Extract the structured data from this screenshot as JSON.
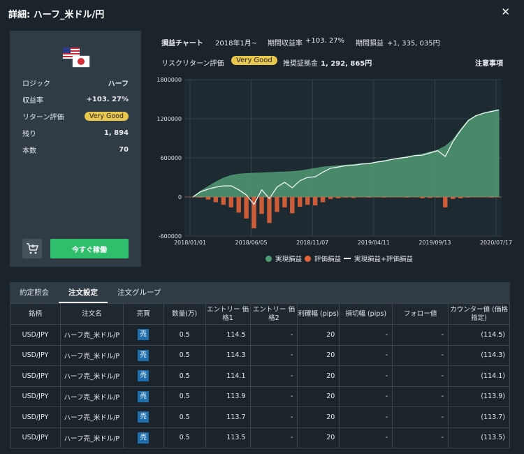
{
  "title": "詳細: ハーフ_米ドル/円",
  "close_icon": "close-icon",
  "card": {
    "rows": [
      {
        "label": "ロジック",
        "value": "ハーフ"
      },
      {
        "label": "収益率",
        "value": "+103. 27%"
      },
      {
        "label": "リターン評価",
        "value": "Very Good"
      },
      {
        "label": "残り",
        "value": "1, 894"
      },
      {
        "label": "本数",
        "value": "70"
      }
    ],
    "cart_icon": "cart-add-icon",
    "operate_label": "今すぐ稼働"
  },
  "header": {
    "chart_label": "損益チャート",
    "start_label": "2018年1月~",
    "period_return_label": "期間収益率",
    "period_return_value": "+103. 27%",
    "period_pl_label": "期間損益",
    "period_pl_value": "+1, 335, 035円",
    "risk_label": "リスクリターン評価",
    "risk_badge": "Very Good",
    "margin_label": "推奨証拠金",
    "margin_value": "1, 292, 865円",
    "notes_label": "注意事項"
  },
  "chart_data": {
    "type": "area",
    "x_ticks": [
      "2018/01/01",
      "2018/06/05",
      "2018/11/07",
      "2019/04/11",
      "2019/09/13",
      "2020/07/17"
    ],
    "y_ticks": [
      "1800000",
      "1200000",
      "600000",
      "0",
      "-600000"
    ],
    "ylim": [
      -600000,
      1800000
    ],
    "grid": true,
    "legend_position": "bottom",
    "series": [
      {
        "name": "実現損益",
        "color": "#4f9a73",
        "kind": "area",
        "values": [
          0,
          90000,
          160000,
          230000,
          290000,
          330000,
          350000,
          360000,
          365000,
          370000,
          375000,
          380000,
          385000,
          390000,
          400000,
          420000,
          440000,
          460000,
          470000,
          480000,
          490000,
          500000,
          510000,
          520000,
          540000,
          560000,
          580000,
          600000,
          620000,
          640000,
          660000,
          690000,
          720000,
          780000,
          880000,
          1040000,
          1180000,
          1250000,
          1290000,
          1320000,
          1340000
        ]
      },
      {
        "name": "評価損益",
        "color": "#e0633a",
        "kind": "bars",
        "values": [
          0,
          -10000,
          -40000,
          -80000,
          -120000,
          -160000,
          -240000,
          -330000,
          -480000,
          -260000,
          -400000,
          -230000,
          -160000,
          -250000,
          -150000,
          -120000,
          -130000,
          -80000,
          -30000,
          -20000,
          -10000,
          -15000,
          -5000,
          -10000,
          -5000,
          -10000,
          -5000,
          -5000,
          -10000,
          -5000,
          -20000,
          -15000,
          -10000,
          -160000,
          -30000,
          -20000,
          -10000,
          -5000,
          -5000,
          -10000,
          -5000
        ]
      },
      {
        "name": "実現損益+評価損益",
        "color": "#ffffff",
        "kind": "line",
        "values": [
          0,
          80000,
          120000,
          150000,
          170000,
          170000,
          110000,
          30000,
          -115000,
          110000,
          -25000,
          150000,
          225000,
          140000,
          250000,
          300000,
          310000,
          380000,
          440000,
          460000,
          480000,
          485000,
          505000,
          510000,
          535000,
          550000,
          575000,
          595000,
          610000,
          635000,
          640000,
          675000,
          710000,
          620000,
          850000,
          1020000,
          1170000,
          1245000,
          1285000,
          1310000,
          1335000
        ]
      }
    ]
  },
  "tabs": [
    "約定照会",
    "注文設定",
    "注文グループ"
  ],
  "table": {
    "headers": [
      "銘柄",
      "注文名",
      "売買",
      "数量(万)",
      "エントリー 価格1",
      "エントリー 価格2",
      "利確幅 (pips)",
      "損切幅 (pips)",
      "フォロー値",
      "カウンター値 (価格指定)"
    ],
    "rows": [
      [
        "USD/JPY",
        "ハーフ売_米ドル/P",
        "売",
        "0.5",
        "114.5",
        "-",
        "20",
        "-",
        "-",
        "(114.5)"
      ],
      [
        "USD/JPY",
        "ハーフ売_米ドル/P",
        "売",
        "0.5",
        "114.3",
        "-",
        "20",
        "-",
        "-",
        "(114.3)"
      ],
      [
        "USD/JPY",
        "ハーフ売_米ドル/P",
        "売",
        "0.5",
        "114.1",
        "-",
        "20",
        "-",
        "-",
        "(114.1)"
      ],
      [
        "USD/JPY",
        "ハーフ売_米ドル/P",
        "売",
        "0.5",
        "113.9",
        "-",
        "20",
        "-",
        "-",
        "(113.9)"
      ],
      [
        "USD/JPY",
        "ハーフ売_米ドル/P",
        "売",
        "0.5",
        "113.7",
        "-",
        "20",
        "-",
        "-",
        "(113.7)"
      ],
      [
        "USD/JPY",
        "ハーフ売_米ドル/P",
        "売",
        "0.5",
        "113.5",
        "-",
        "20",
        "-",
        "-",
        "(113.5)"
      ]
    ]
  }
}
